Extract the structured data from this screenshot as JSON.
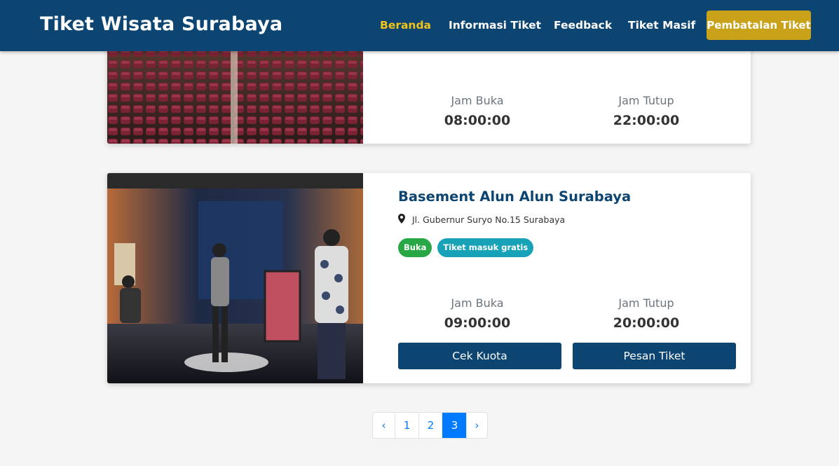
{
  "brand": "Tiket Wisata Surabaya",
  "nav": {
    "items": [
      {
        "label": "Beranda",
        "active": true
      },
      {
        "label": "Informasi Tiket",
        "active": false
      },
      {
        "label": "Feedback",
        "active": false
      },
      {
        "label": "Tiket Masif",
        "active": false
      }
    ],
    "cta_label": "Pembatalan Tiket"
  },
  "cards": [
    {
      "image": "auditorium-seats-photo",
      "open_label": "Jam Buka",
      "open_time": "08:00:00",
      "close_label": "Jam Tutup",
      "close_time": "22:00:00"
    },
    {
      "image": "art-exhibition-photo",
      "title": "Basement Alun Alun Surabaya",
      "address_icon": "map-marker-icon",
      "address": "Jl. Gubernur Suryo No.15 Surabaya",
      "badges": [
        {
          "label": "Buka",
          "color": "#28a745"
        },
        {
          "label": "Tiket masuk gratis",
          "color": "#17a2b8"
        }
      ],
      "open_label": "Jam Buka",
      "open_time": "09:00:00",
      "close_label": "Jam Tutup",
      "close_time": "20:00:00",
      "buttons": {
        "check_quota": "Cek Kuota",
        "order": "Pesan Tiket"
      }
    }
  ],
  "pagination": {
    "prev": "‹",
    "pages": [
      "1",
      "2",
      "3"
    ],
    "current": "3",
    "next": "›"
  },
  "colors": {
    "navbar": "#0c4472",
    "nav_active": "#f2c31b",
    "cta": "#c9a21a",
    "primary_button": "#0c4472",
    "page_active": "#007bff"
  }
}
